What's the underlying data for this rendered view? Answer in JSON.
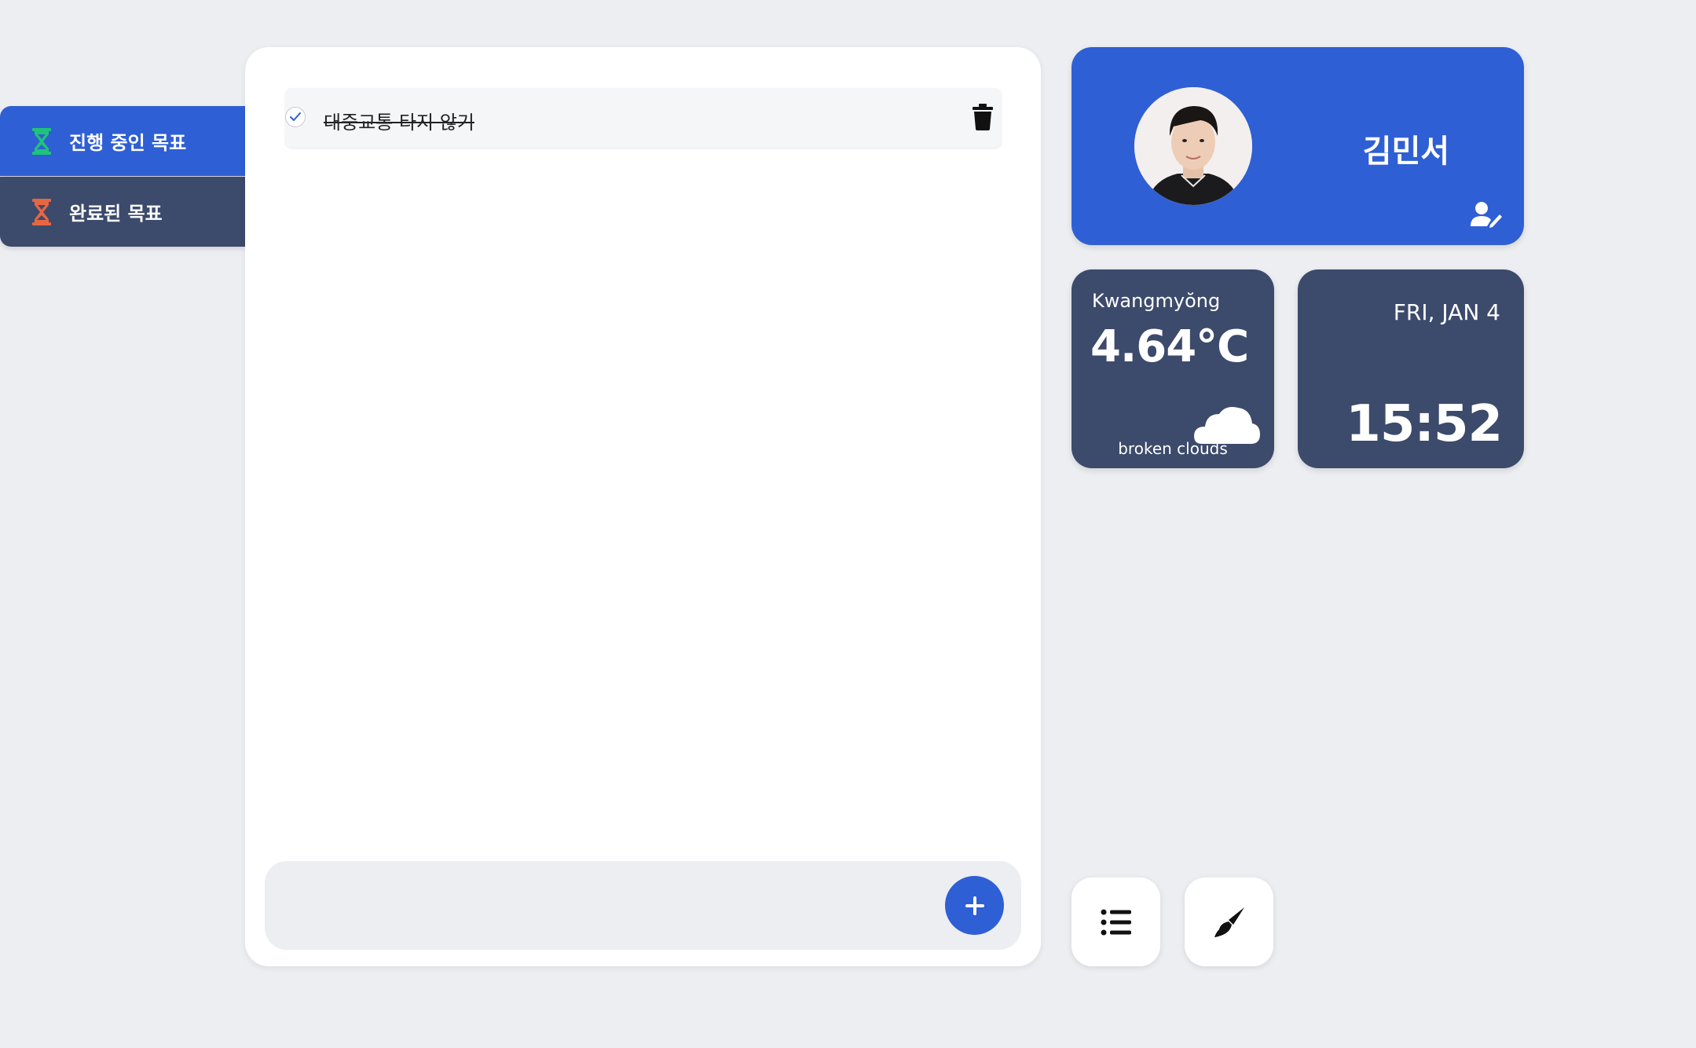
{
  "colors": {
    "background": "#eceef2",
    "accent": "#2f5fd4",
    "navy": "#3c4a6b",
    "panel": "#ffffff",
    "in_progress_icon": "#1fc37a",
    "done_icon": "#e8663f"
  },
  "sidebar": {
    "items": [
      {
        "label": "진행 중인 목표",
        "icon": "hourglass-icon",
        "icon_color": "#1fc37a",
        "active": true
      },
      {
        "label": "완료된 목표",
        "icon": "hourglass-icon",
        "icon_color": "#e8663f",
        "active": false
      }
    ]
  },
  "todos": {
    "items": [
      {
        "text": "대중교통 타지 않기",
        "completed": true
      }
    ],
    "new_todo": {
      "value": "",
      "placeholder": ""
    }
  },
  "profile": {
    "name": "김민서",
    "avatar_icon": "avatar-photo",
    "edit_icon": "user-edit-icon"
  },
  "weather": {
    "city": "Kwangmyŏng",
    "temperature": "4.64°C",
    "description": "broken clouds",
    "icon": "cloud-icon"
  },
  "clock": {
    "date": "FRI, JAN 4",
    "time": "15:52"
  },
  "tools": [
    {
      "icon": "list-icon"
    },
    {
      "icon": "paintbrush-icon"
    }
  ]
}
